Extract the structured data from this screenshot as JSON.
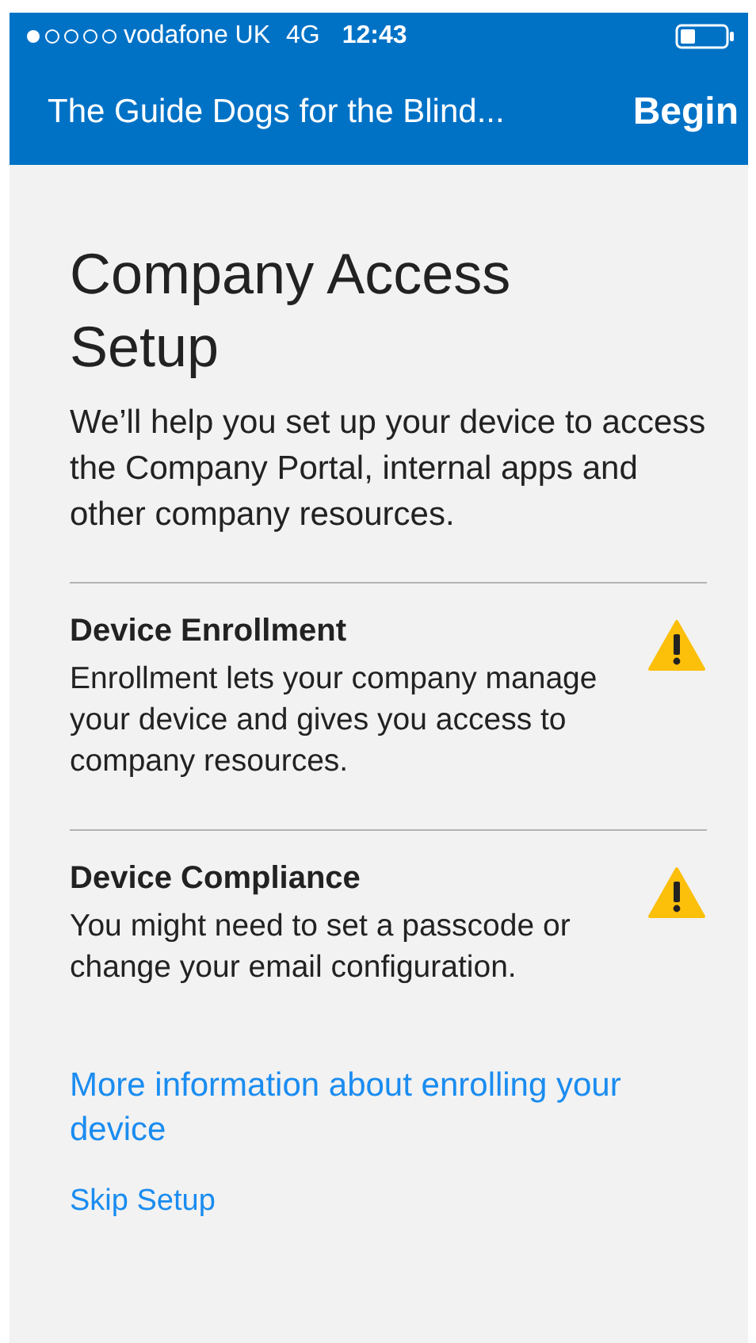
{
  "status_bar": {
    "carrier": "vodafone UK",
    "network": "4G",
    "time": "12:43"
  },
  "nav_bar": {
    "title": "The Guide Dogs for the Blind...",
    "action": "Begin"
  },
  "heading": "Company Access Setup",
  "intro": "We’ll help you set up your device to access the Company Portal, internal apps and other company resources.",
  "sections": [
    {
      "title": "Device Enrollment",
      "text": "Enrollment lets your company manage your device and gives you access to company resources.",
      "warning": true
    },
    {
      "title": "Device Compliance",
      "text": "You might need to set a passcode or change your email configuration.",
      "warning": true
    }
  ],
  "more_info_link": "More information about enrolling your device",
  "skip_link": "Skip Setup"
}
